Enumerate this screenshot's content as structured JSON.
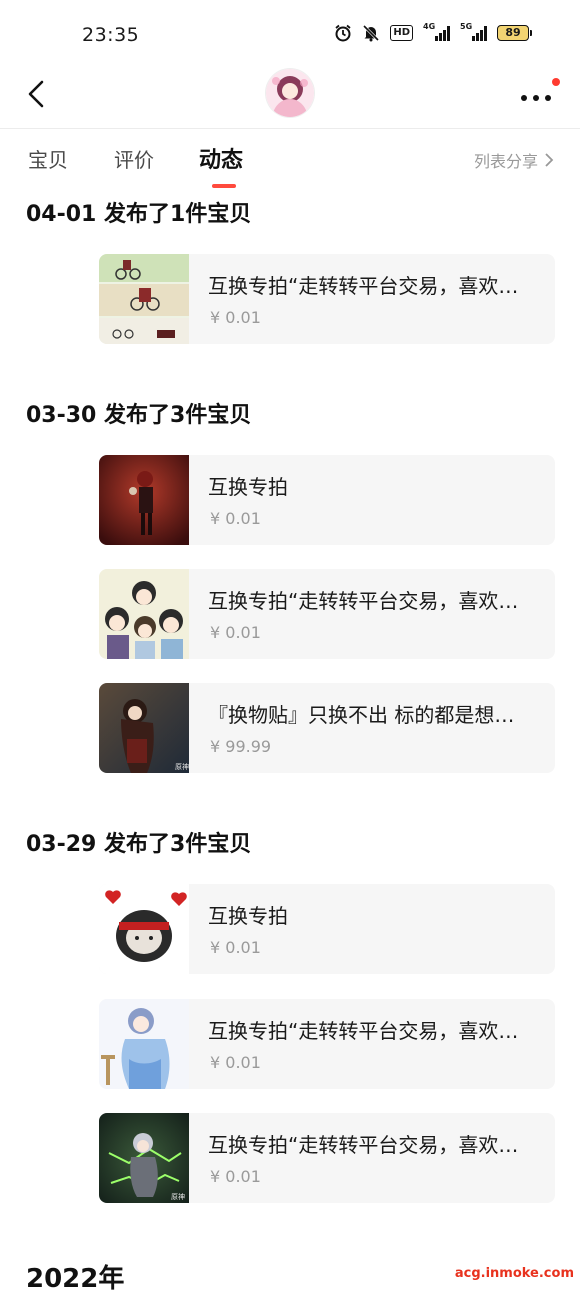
{
  "status_bar": {
    "time": "23:35",
    "icons": [
      "alarm-icon",
      "mute-bell-icon",
      "hd-icon",
      "signal-4g-icon",
      "signal-5g-icon",
      "battery-icon"
    ],
    "hd_label": "HD",
    "net1_label": "4G",
    "net2_label": "5G",
    "battery_level": "89"
  },
  "nav": {
    "back_icon": "chevron-left-icon",
    "avatar": "user-avatar",
    "more_icon": "more-dots-icon",
    "notification_dot_color": "#ff3b30"
  },
  "tabs": {
    "items": [
      {
        "label": "宝贝",
        "active": false
      },
      {
        "label": "评价",
        "active": false
      },
      {
        "label": "动态",
        "active": true
      }
    ],
    "share_label": "列表分享",
    "accent_color": "#ff4a3d"
  },
  "groups": [
    {
      "title": "04-01 发布了1件宝贝",
      "items": [
        {
          "title": "互换专拍“走转转平台交易，喜欢的宝贝可以拍下",
          "price": "¥ 0.01",
          "thumb": "bicycle-comic"
        }
      ]
    },
    {
      "title": "03-30 发布了3件宝贝",
      "items": [
        {
          "title": "互换专拍",
          "price": "¥ 0.01",
          "thumb": "red-hair-figure"
        },
        {
          "title": "互换专拍“走转转平台交易，喜欢的宝贝可以拍下",
          "price": "¥ 0.01",
          "thumb": "chibi-group"
        },
        {
          "title": "『换物贴』只换不出 标的都是想换的东西",
          "price": "¥ 99.99",
          "thumb": "dark-hair-girl"
        }
      ]
    },
    {
      "title": "03-29 发布了3件宝贝",
      "items": [
        {
          "title": "互换专拍",
          "price": "¥ 0.01",
          "thumb": "heart-meme"
        },
        {
          "title": "互换专拍“走转转平台交易，喜欢的宝贝可以拍下",
          "price": "¥ 0.01",
          "thumb": "blue-dress-girl"
        },
        {
          "title": "互换专拍“走转转平台交易，喜欢的宝贝可以拍下",
          "price": "¥ 0.01",
          "thumb": "green-glow-girl"
        }
      ]
    }
  ],
  "year_label": "2022年",
  "watermark": "acg.inmoke.com"
}
